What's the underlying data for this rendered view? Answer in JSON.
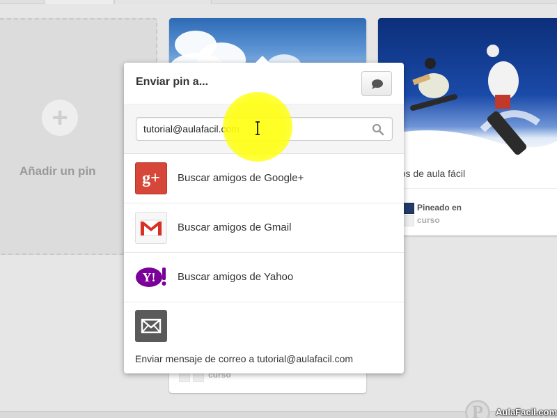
{
  "add_pin": {
    "label": "Añadir un pin",
    "icon": "plus-icon"
  },
  "card_left": {
    "board_label": "curso"
  },
  "card_right": {
    "caption": "rsos de aula fácil",
    "pinned_label": "Pineado en",
    "board_label": "curso"
  },
  "popup": {
    "title": "Enviar pin a...",
    "message_button_icon": "speech-bubble-icon",
    "search": {
      "value": "tutorial@aulafacil.com",
      "icon": "search-icon"
    },
    "friends": [
      {
        "label": "Buscar amigos de Google+",
        "icon": "google-plus-icon",
        "glyph": "g+"
      },
      {
        "label": "Buscar amigos de Gmail",
        "icon": "gmail-icon"
      },
      {
        "label": "Buscar amigos de Yahoo",
        "icon": "yahoo-icon",
        "glyph": "Y!"
      }
    ],
    "email_message": "Enviar mensaje de correo a tutorial@aulafacil.com",
    "email_icon": "envelope-icon"
  },
  "watermark": "AulaFacil.com",
  "colors": {
    "google_plus": "#d6473a",
    "yahoo": "#7b0099",
    "highlight": "#ffff1a"
  }
}
